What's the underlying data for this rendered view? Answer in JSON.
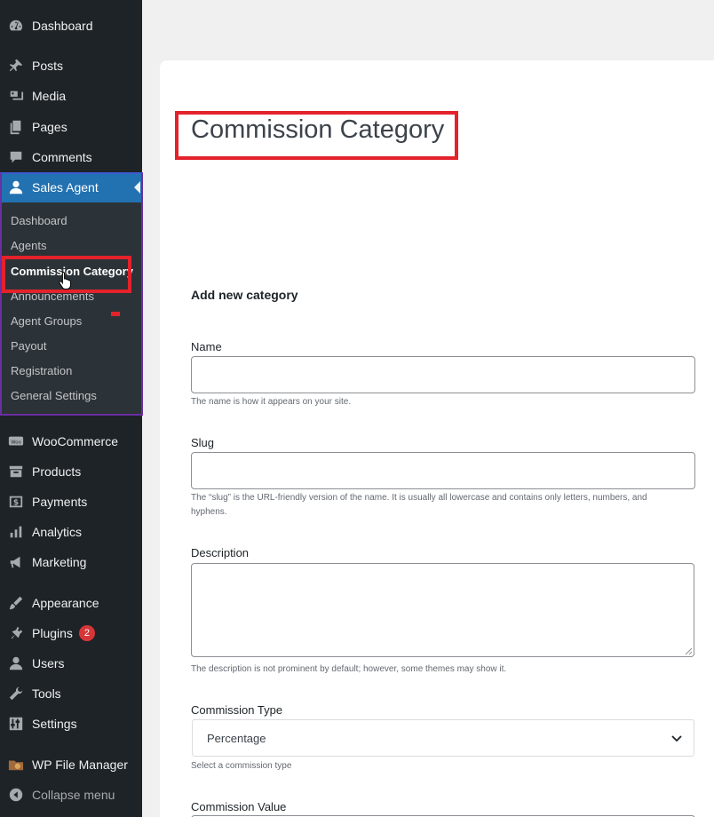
{
  "sidebar": {
    "items": [
      {
        "label": "Dashboard",
        "icon": "dashboard-icon"
      },
      {
        "label": "Posts",
        "icon": "pin-icon"
      },
      {
        "label": "Media",
        "icon": "media-icon"
      },
      {
        "label": "Pages",
        "icon": "pages-icon"
      },
      {
        "label": "Comments",
        "icon": "comment-icon"
      },
      {
        "label": "Sales Agent",
        "icon": "user-icon"
      },
      {
        "label": "WooCommerce",
        "icon": "woo-icon"
      },
      {
        "label": "Products",
        "icon": "archive-icon"
      },
      {
        "label": "Payments",
        "icon": "dollar-icon"
      },
      {
        "label": "Analytics",
        "icon": "bar-chart-icon"
      },
      {
        "label": "Marketing",
        "icon": "megaphone-icon"
      },
      {
        "label": "Appearance",
        "icon": "brush-icon"
      },
      {
        "label": "Plugins",
        "icon": "plugin-icon",
        "badge": "2"
      },
      {
        "label": "Users",
        "icon": "users-icon"
      },
      {
        "label": "Tools",
        "icon": "wrench-icon"
      },
      {
        "label": "Settings",
        "icon": "settings-icon"
      },
      {
        "label": "WP File Manager",
        "icon": "file-manager-icon"
      },
      {
        "label": "Collapse menu",
        "icon": "collapse-icon"
      }
    ],
    "submenu": [
      "Dashboard",
      "Agents",
      "Commission Category",
      "Announcements",
      "Agent Groups",
      "Payout",
      "Registration",
      "General Settings"
    ]
  },
  "main": {
    "page_title": "Commission Category",
    "section_title": "Add new category",
    "name": {
      "label": "Name",
      "value": "",
      "hint": "The name is how it appears on your site."
    },
    "slug": {
      "label": "Slug",
      "value": "",
      "hint": "The “slug” is the URL-friendly version of the name. It is usually all lowercase and contains only letters, numbers, and hyphens."
    },
    "description": {
      "label": "Description",
      "value": "",
      "hint": "The description is not prominent by default; however, some themes may show it."
    },
    "commission_type": {
      "label": "Commission Type",
      "selected": "Percentage",
      "hint": "Select a commission type"
    },
    "commission_value": {
      "label": "Commission Value"
    }
  },
  "colors": {
    "sidebar_bg": "#1d2327",
    "active_bg": "#2271b1",
    "highlight_red": "#e3222c",
    "badge_red": "#d63638"
  }
}
